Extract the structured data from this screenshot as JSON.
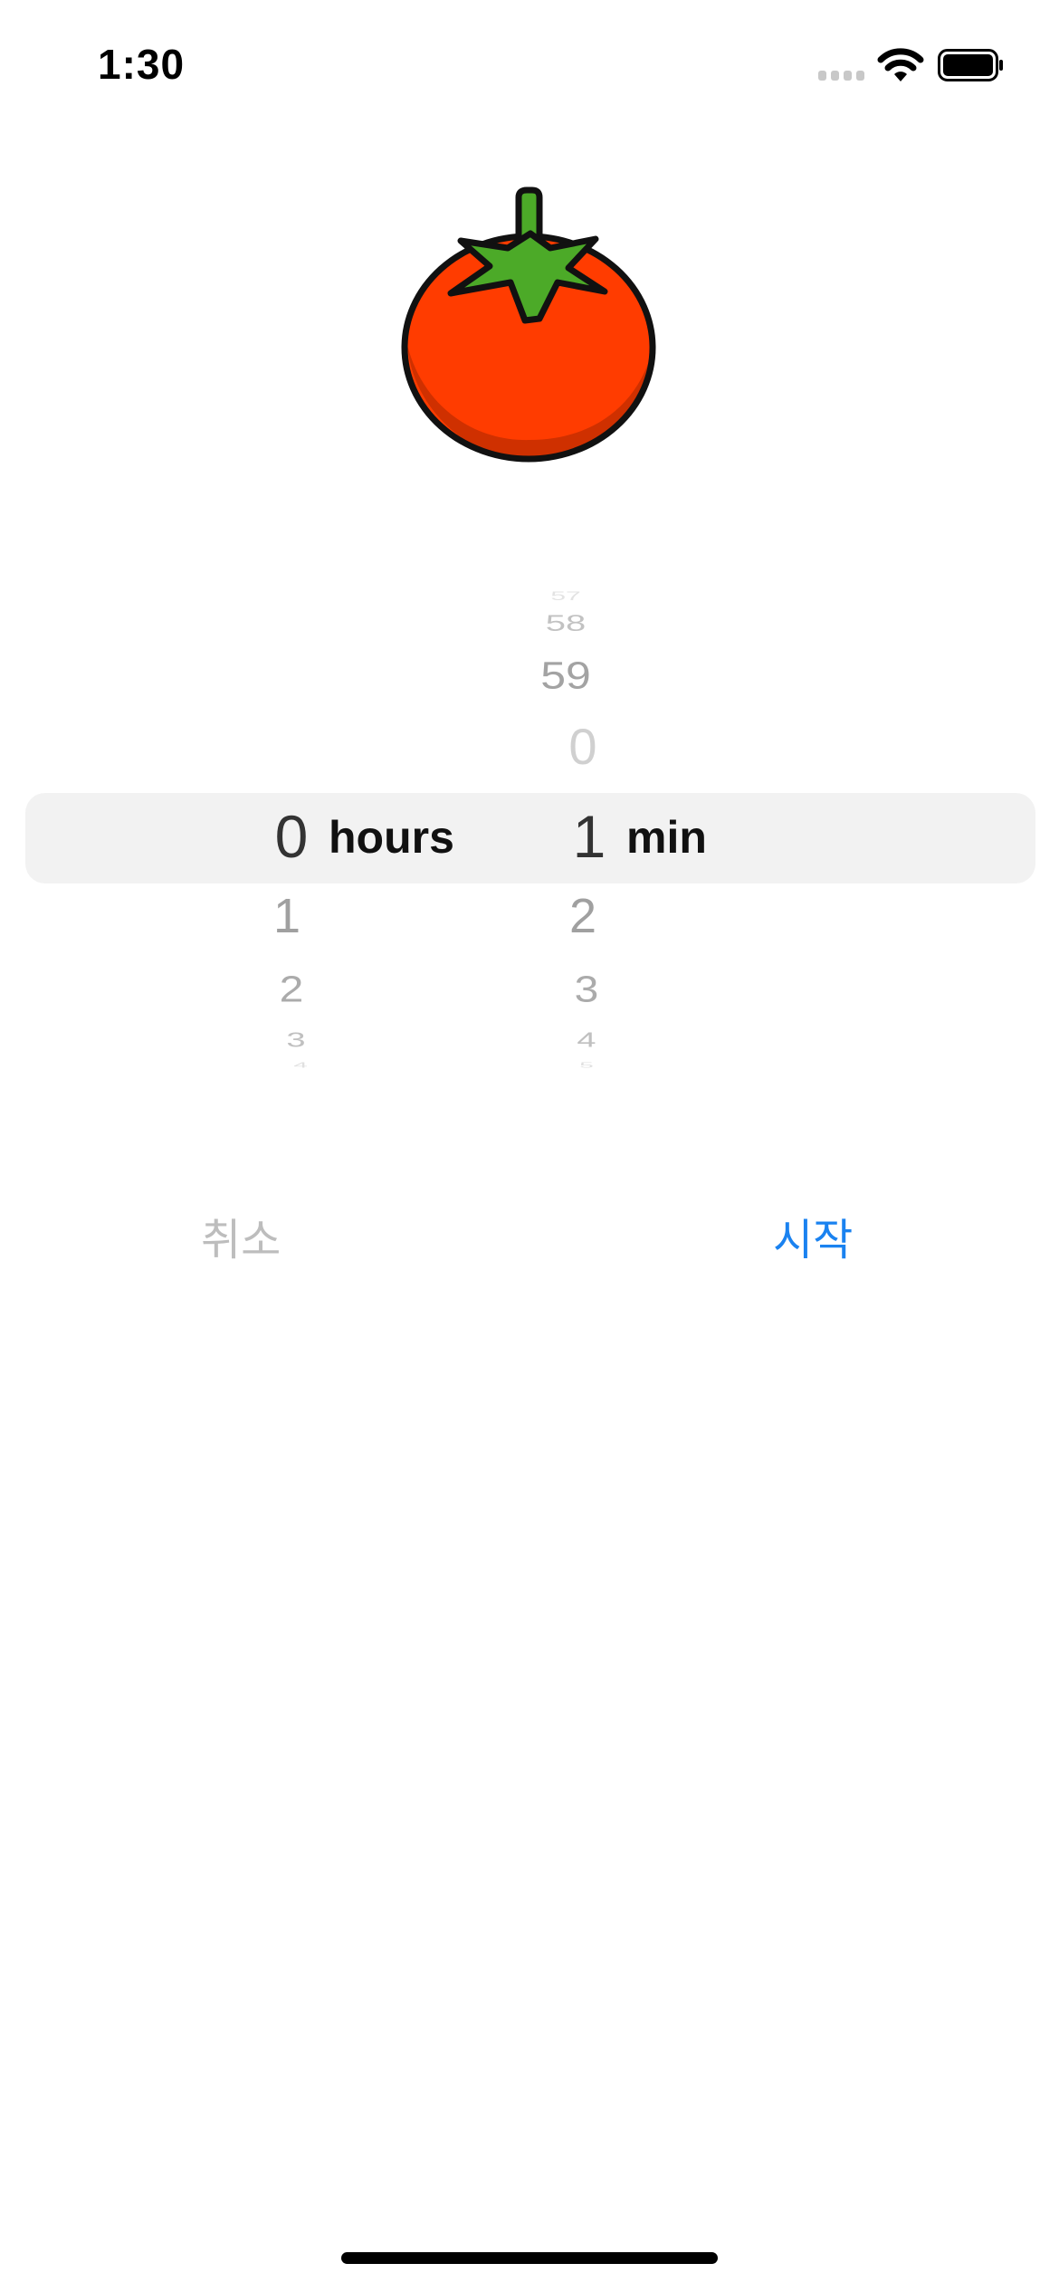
{
  "status_bar": {
    "time": "1:30"
  },
  "picker": {
    "hours": {
      "unit_label": "hours",
      "selected": "0",
      "below": [
        "1",
        "2",
        "3",
        "4"
      ]
    },
    "minutes": {
      "unit_label": "min",
      "above": [
        "57",
        "58",
        "59",
        "0"
      ],
      "selected": "1",
      "below": [
        "2",
        "3",
        "4",
        "5"
      ]
    }
  },
  "actions": {
    "cancel_label": "취소",
    "start_label": "시작"
  },
  "colors": {
    "accent": "#1a82f0",
    "disabled": "#bdbdbd",
    "tomato": "#ff3c00",
    "leaf": "#4caa28",
    "band": "#f2f2f2"
  }
}
